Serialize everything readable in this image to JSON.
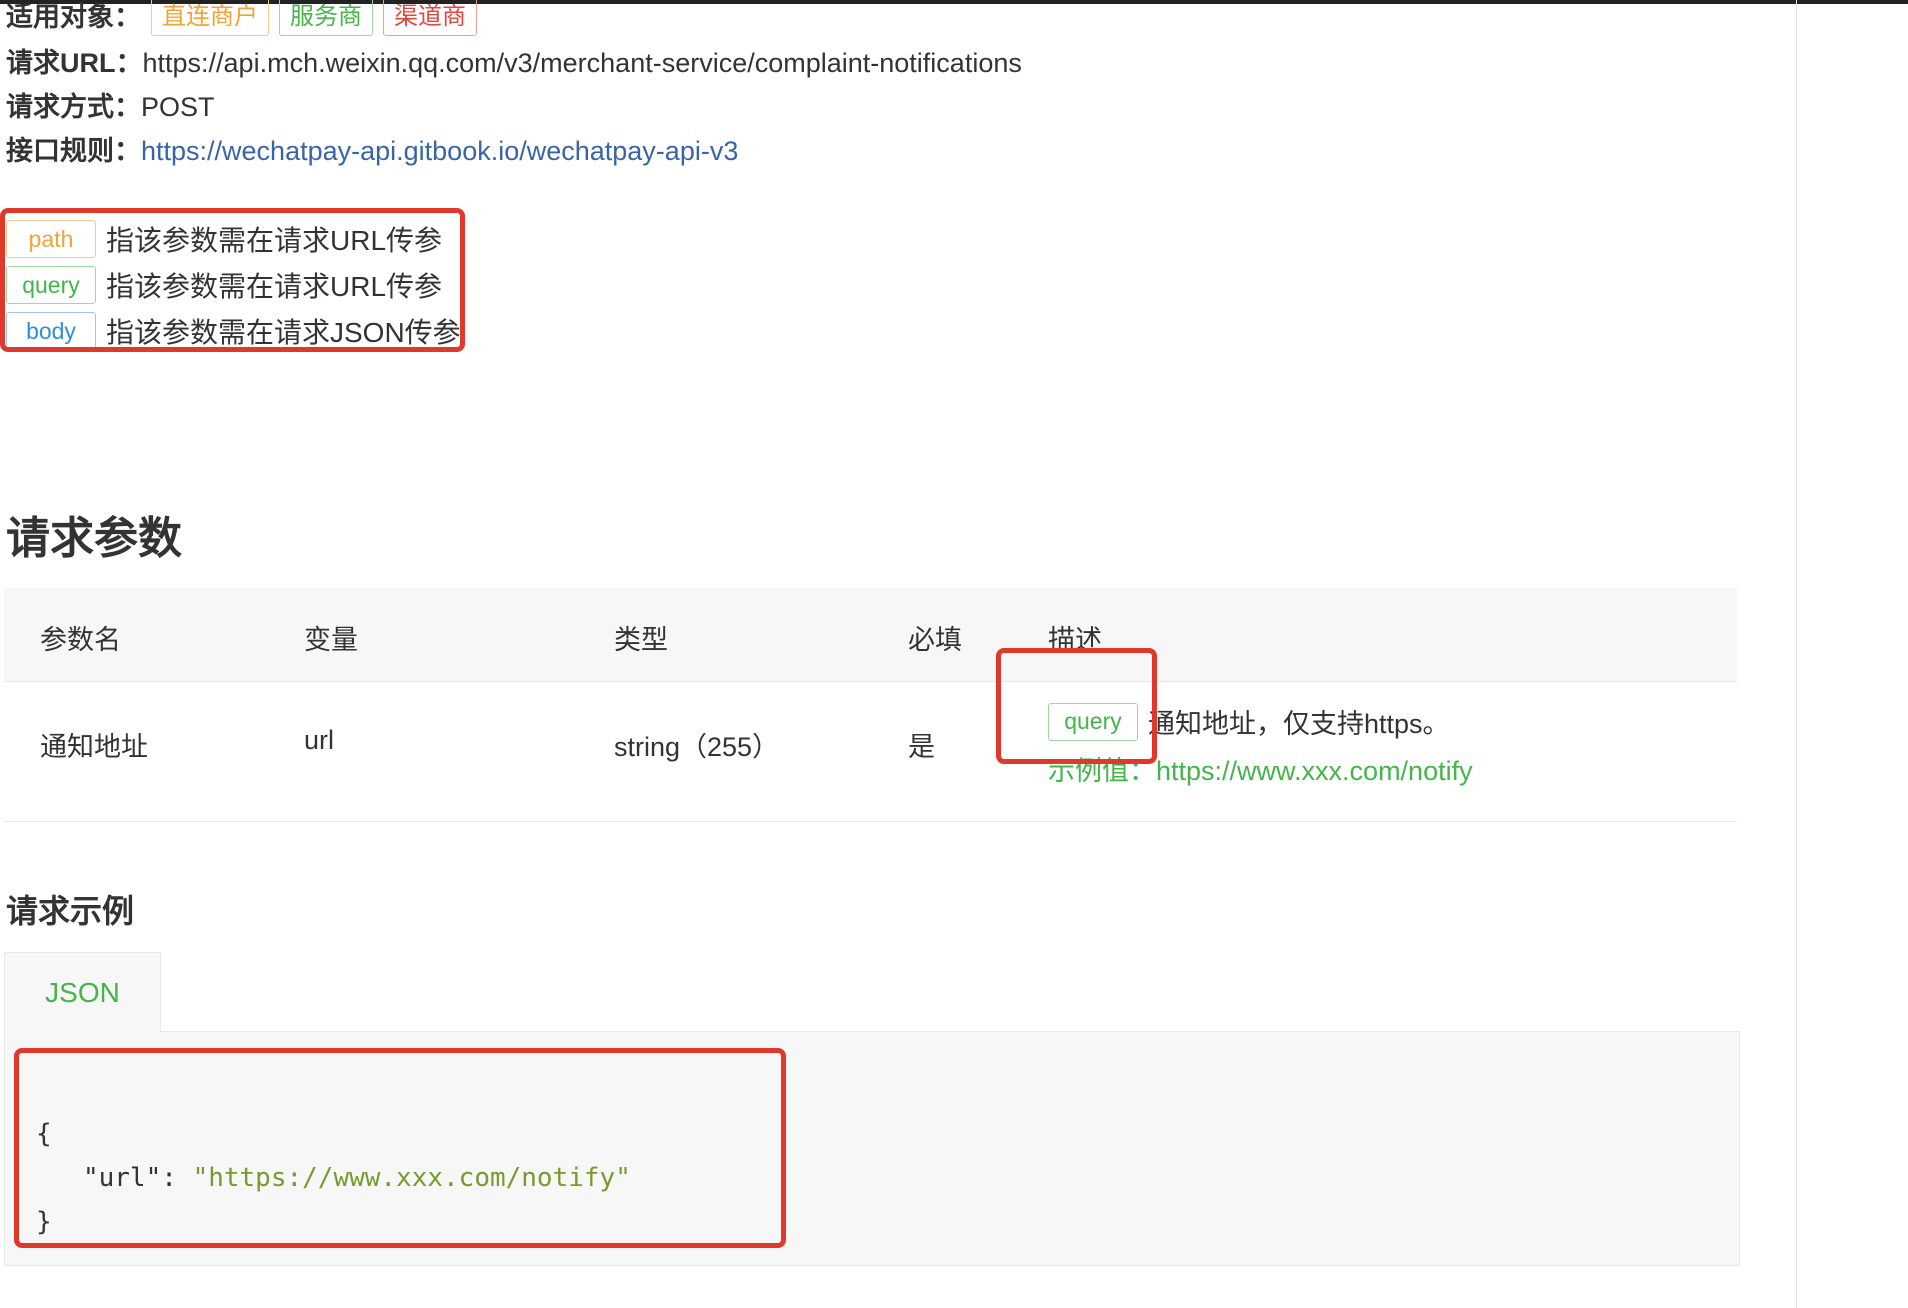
{
  "meta": {
    "applicable_label": "适用对象：",
    "applicable_tags": [
      {
        "label": "直连商户",
        "color": "#f2a33a"
      },
      {
        "label": "服务商",
        "color": "#44b549"
      },
      {
        "label": "渠道商",
        "color": "#e0463c"
      }
    ],
    "url_label": "请求URL：",
    "url_value": "https://api.mch.weixin.qq.com/v3/merchant-service/complaint-notifications",
    "method_label": "请求方式：",
    "method_value": "POST",
    "rules_label": "接口规则：",
    "rules_link": "https://wechatpay-api.gitbook.io/wechatpay-api-v3"
  },
  "legend": [
    {
      "tag": "path",
      "text": "指该参数需在请求URL传参",
      "color": "#f2a33a"
    },
    {
      "tag": "query",
      "text": "指该参数需在请求URL传参",
      "color": "#44b549"
    },
    {
      "tag": "body",
      "text": "指该参数需在请求JSON传参",
      "color": "#2e8fdc"
    }
  ],
  "params_section": {
    "title": "请求参数",
    "headers": [
      "参数名",
      "变量",
      "类型",
      "必填",
      "描述"
    ],
    "rows": [
      {
        "name": "通知地址",
        "variable": "url",
        "type": "string（255）",
        "required": "是",
        "tag": "query",
        "description": "通知地址，仅支持https。",
        "example_label": "示例值：",
        "example_value": "https://www.xxx.com/notify"
      }
    ]
  },
  "example_section": {
    "title": "请求示例",
    "tab_label": "JSON",
    "code": {
      "open": "{",
      "key": "\"url\"",
      "colon": ": ",
      "value": "\"https://www.xxx.com/notify\"",
      "close": "}"
    }
  },
  "colors": {
    "accent_green": "#44b549",
    "link_blue": "#3a64a8",
    "highlight_red": "#e0382b"
  }
}
